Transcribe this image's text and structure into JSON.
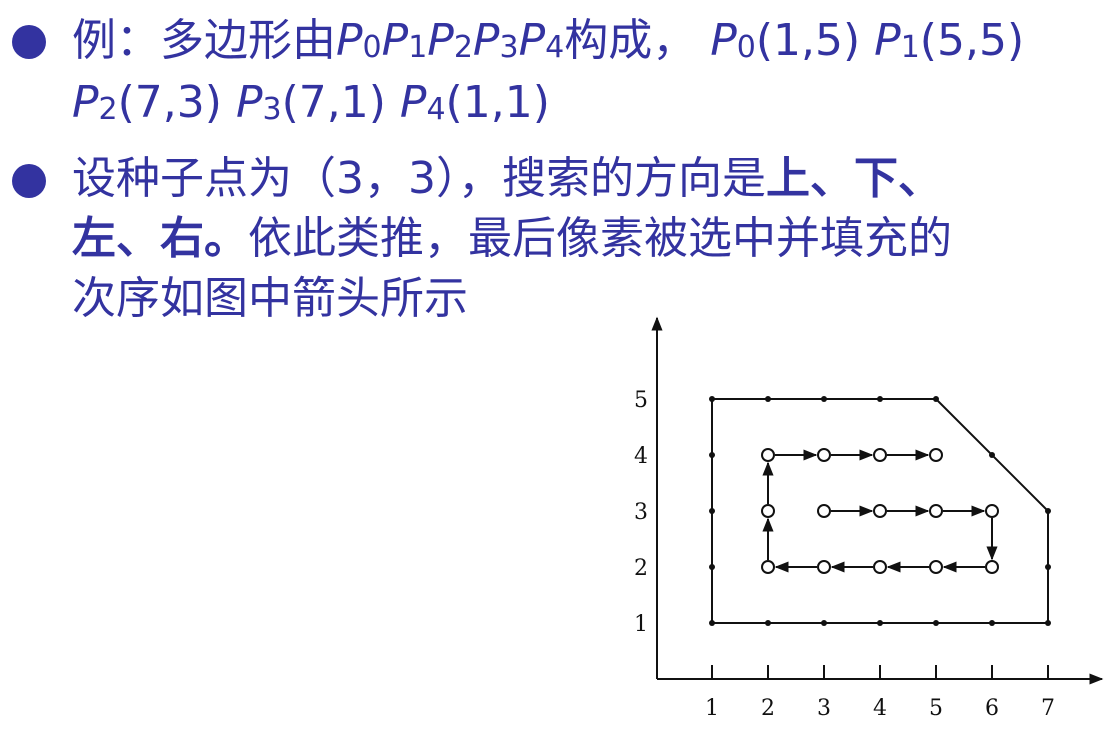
{
  "bullet1": {
    "line1": {
      "lead": "例：多边形由",
      "poly": [
        {
          "p": "P",
          "s": "0"
        },
        {
          "p": "P",
          "s": "1"
        },
        {
          "p": "P",
          "s": "2"
        },
        {
          "p": "P",
          "s": "3"
        },
        {
          "p": "P",
          "s": "4"
        }
      ],
      "made": "构成，",
      "pts": [
        {
          "p": "P",
          "s": "0",
          "c": "(1,5)"
        },
        {
          "p": "P",
          "s": "1",
          "c": "(5,5)"
        }
      ]
    },
    "line2": {
      "pts": [
        {
          "p": "P",
          "s": "2",
          "c": "(7,3)"
        },
        {
          "p": "P",
          "s": "3",
          "c": "(7,1)"
        },
        {
          "p": "P",
          "s": "4",
          "c": "(1,1)"
        }
      ]
    }
  },
  "bullet2": {
    "line1": {
      "text": "设种子点为（3，3），搜索的方向是",
      "bold1": "上",
      "sep1": "、",
      "bold2": "下",
      "sep2": "、"
    },
    "line2": {
      "bold1": "左",
      "sep1": "、",
      "bold2": "右",
      "end": "。",
      "text": "依此类推，最后像素被选中并填充的"
    },
    "line3": {
      "text": "次序如图中箭头所示"
    }
  },
  "diagram": {
    "x_ticks": [
      "1",
      "2",
      "3",
      "4",
      "5",
      "6",
      "7"
    ],
    "y_ticks": [
      "1",
      "2",
      "3",
      "4",
      "5"
    ],
    "polygon": [
      [
        1,
        5
      ],
      [
        5,
        5
      ],
      [
        7,
        3
      ],
      [
        7,
        1
      ],
      [
        1,
        1
      ]
    ],
    "fill_path": [
      [
        3,
        3
      ],
      [
        4,
        3
      ],
      [
        5,
        3
      ],
      [
        6,
        3
      ],
      [
        6,
        2
      ],
      [
        5,
        2
      ],
      [
        4,
        2
      ],
      [
        3,
        2
      ],
      [
        2,
        2
      ],
      [
        2,
        3
      ],
      [
        2,
        4
      ],
      [
        3,
        4
      ],
      [
        4,
        4
      ],
      [
        5,
        4
      ]
    ],
    "colors": {
      "text": "#3333a0",
      "line": "#111111"
    }
  }
}
